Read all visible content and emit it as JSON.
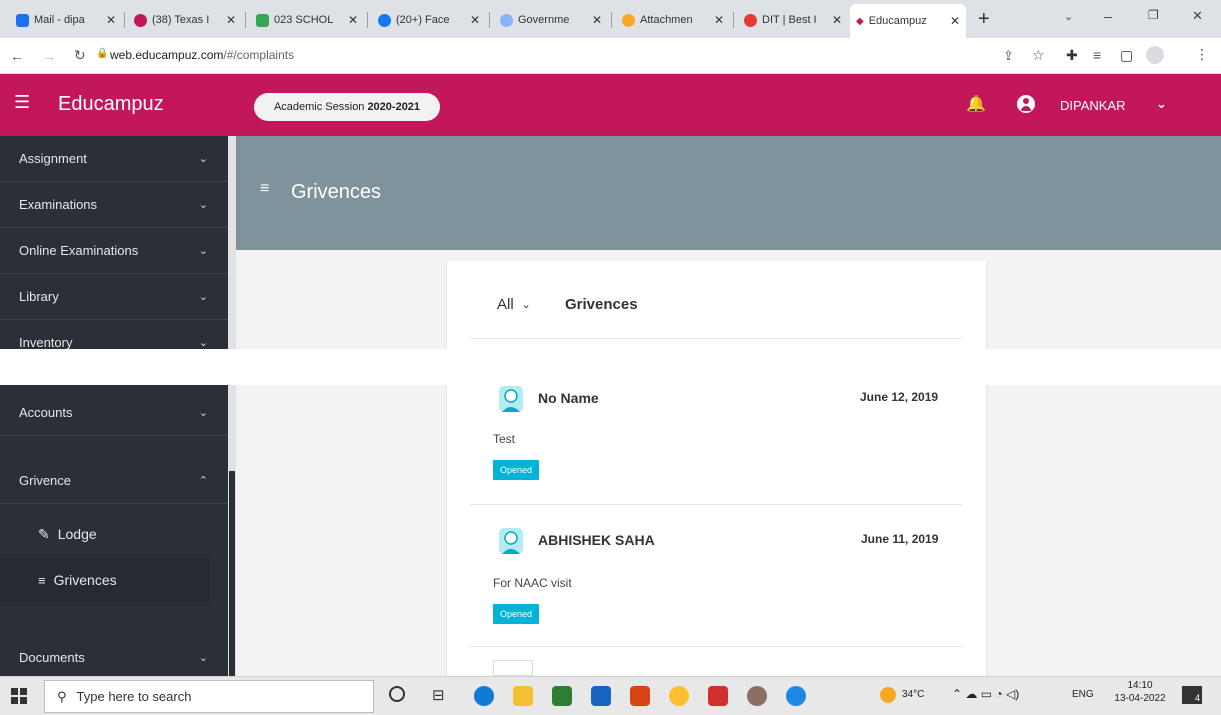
{
  "browser": {
    "tabs": [
      {
        "label": "Mail - dipa",
        "icon": "mail-icon",
        "color": "#1a73e8"
      },
      {
        "label": "(38) Texas I",
        "icon": "heart-icon",
        "color": "#c2185b"
      },
      {
        "label": "023 SCHOL",
        "icon": "drive-icon",
        "color": "#34a853"
      },
      {
        "label": "(20+) Face",
        "icon": "facebook-icon",
        "color": "#1877f2"
      },
      {
        "label": "Governme",
        "icon": "globe-icon",
        "color": "#1a73e8"
      },
      {
        "label": "Attachmen",
        "icon": "attachment-icon",
        "color": "#f9a825"
      },
      {
        "label": "DIT | Best I",
        "icon": "dit-icon",
        "color": "#e53935"
      },
      {
        "label": "Educampuz",
        "icon": "educampuz-icon",
        "color": "#c2185b",
        "active": true
      }
    ],
    "url_host": "web.educampuz.com",
    "url_path": "/#/complaints"
  },
  "app": {
    "brand": "Educampuz",
    "session_label": "Academic Session",
    "session_value": "2020-2021",
    "user": "DIPANKAR",
    "accent": "#c2185b"
  },
  "sidebar": {
    "items": [
      {
        "label": "Assignment",
        "chevron": "⌄"
      },
      {
        "label": "Examinations",
        "chevron": "⌄"
      },
      {
        "label": "Online Examinations",
        "chevron": "⌄"
      },
      {
        "label": "Library",
        "chevron": "⌄"
      },
      {
        "label": "Inventory",
        "chevron": "⌄"
      },
      {
        "label": "Accounts",
        "chevron": "⌄"
      },
      {
        "label": "Grivence",
        "chevron": "⌃"
      },
      {
        "label": "Documents",
        "chevron": "⌄"
      }
    ],
    "sub_items": [
      {
        "label": "Lodge",
        "icon": "pencil-icon"
      },
      {
        "label": "Grivences",
        "icon": "list-icon"
      }
    ]
  },
  "page": {
    "title": "Grivences",
    "filter_value": "All",
    "card_title": "Grivences",
    "entries": [
      {
        "name": "No Name",
        "date": "June 12, 2019",
        "message": "Test",
        "status": "Opened"
      },
      {
        "name": "ABHISHEK SAHA",
        "date": "June 11, 2019",
        "message": "For NAAC visit",
        "status": "Opened"
      }
    ]
  },
  "taskbar": {
    "search_placeholder": "Type here to search",
    "weather": "34°C",
    "lang": "ENG",
    "time": "14:10",
    "date": "13-04-2022",
    "notifications": "4"
  }
}
